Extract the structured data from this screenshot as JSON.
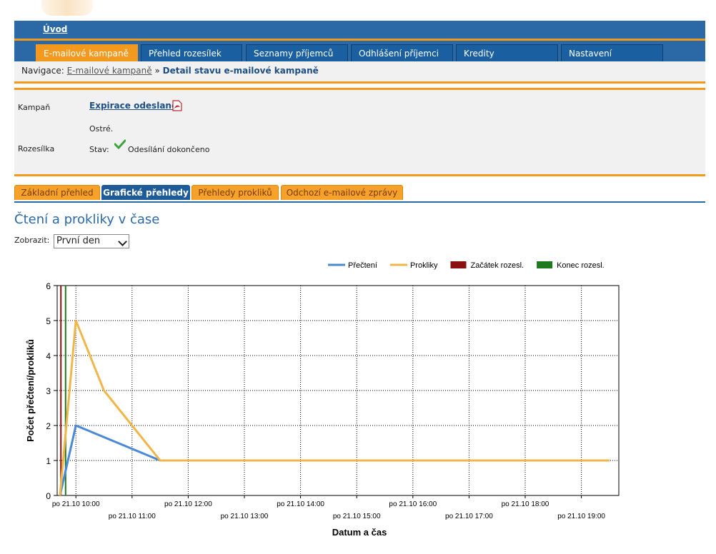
{
  "topbar": {
    "home_link": "Úvod"
  },
  "main_nav": {
    "tabs": [
      {
        "label": "E-mailové kampaně",
        "active": true
      },
      {
        "label": "Přehled rozesílek",
        "active": false
      },
      {
        "label": "Seznamy příjemců",
        "active": false
      },
      {
        "label": "Odhlášení příjemci",
        "active": false
      },
      {
        "label": "Kredity",
        "active": false
      },
      {
        "label": "Nastavení",
        "active": false
      }
    ]
  },
  "breadcrumb": {
    "prefix": "Navigace:",
    "link": "E-mailové kampaně",
    "separator": "»",
    "current": "Detail stavu e-mailové kampaně"
  },
  "campaign": {
    "label": "Kampaň",
    "name": "Expirace odeslané",
    "pdf_icon": "pdf-icon",
    "mode": "Ostré.",
    "dispatch_label": "Rozesílka",
    "status_label": "Stav:",
    "status_icon": "check-icon",
    "status_value": "Odesílání dokončeno"
  },
  "sub_tabs": [
    {
      "label": "Základní přehled",
      "active": false
    },
    {
      "label": "Grafické přehledy",
      "active": true
    },
    {
      "label": "Přehledy prokliků",
      "active": false
    },
    {
      "label": "Odchozí e-mailové zprávy",
      "active": false
    }
  ],
  "section_title": "Čtení a prokliky v čase",
  "filter": {
    "label": "Zobrazit:",
    "value": "První den"
  },
  "colors": {
    "accent": "#f39a1e",
    "nav": "#2a69a6",
    "reads": "#4a88d8",
    "clicks": "#f0b64a",
    "start": "#8b1010",
    "end": "#1f7a1f"
  },
  "chart_data": {
    "type": "line",
    "ylabel": "Počet přečtení/prokliků",
    "xlabel": "Datum a čas",
    "ylim": [
      0,
      6
    ],
    "yticks": [
      0,
      1,
      2,
      3,
      4,
      5,
      6
    ],
    "xlim": [
      "21.10 09:40",
      "21.10 19:40"
    ],
    "xticks": [
      "po 21.10 10:00",
      "po 21.10 11:00",
      "po 21.10 12:00",
      "po 21.10 13:00",
      "po 21.10 14:00",
      "po 21.10 15:00",
      "po 21.10 16:00",
      "po 21.10 17:00",
      "po 21.10 18:00",
      "po 21.10 19:00"
    ],
    "legend_position": "top-right",
    "grid": true,
    "series": [
      {
        "name": "Přečtení",
        "color": "#4a88d8",
        "points": [
          [
            "21.10 09:43",
            0
          ],
          [
            "21.10 10:00",
            2
          ],
          [
            "21.10 11:30",
            1
          ],
          [
            "21.10 19:30",
            1
          ]
        ]
      },
      {
        "name": "Prokliky",
        "color": "#f0b64a",
        "points": [
          [
            "21.10 09:43",
            0
          ],
          [
            "21.10 10:00",
            5
          ],
          [
            "21.10 10:30",
            3
          ],
          [
            "21.10 11:30",
            1
          ],
          [
            "21.10 19:30",
            1
          ]
        ]
      },
      {
        "name": "Začátek rozesl.",
        "color": "#8b1010",
        "marker": "vline",
        "x": "21.10 09:44"
      },
      {
        "name": "Konec rozesl.",
        "color": "#1f7a1f",
        "marker": "vline",
        "x": "21.10 09:49"
      }
    ]
  }
}
